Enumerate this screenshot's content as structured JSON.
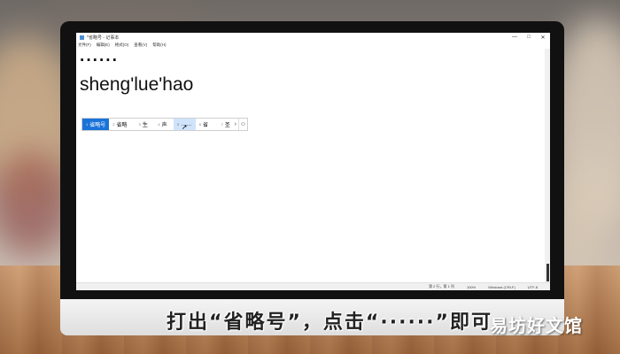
{
  "window": {
    "title": "*省略号 - 记事本",
    "minimize": "—",
    "maximize": "□",
    "close": "✕"
  },
  "menu": [
    "文件(F)",
    "编辑(E)",
    "格式(O)",
    "查看(V)",
    "帮助(H)"
  ],
  "document": {
    "line1": "······",
    "line2": "sheng'lue'hao"
  },
  "ime": {
    "candidates": [
      {
        "num": "1",
        "text": "省略号"
      },
      {
        "num": "2",
        "text": "省略"
      },
      {
        "num": "3",
        "text": "生"
      },
      {
        "num": "4",
        "text": "声"
      },
      {
        "num": "5",
        "text": "……"
      },
      {
        "num": "6",
        "text": "省"
      },
      {
        "num": "7",
        "text": "圣"
      }
    ],
    "next_icon": "chevron-right-icon",
    "emoji_icon": "smiley-icon"
  },
  "statusbar": {
    "position": "第 2 行，第 1 列",
    "zoom": "100%",
    "line_ending": "Windows (CRLF)",
    "encoding": "UTF-8"
  },
  "caption": "打出“省略号”，点击“······”即可",
  "watermark": "易坊好文馆"
}
